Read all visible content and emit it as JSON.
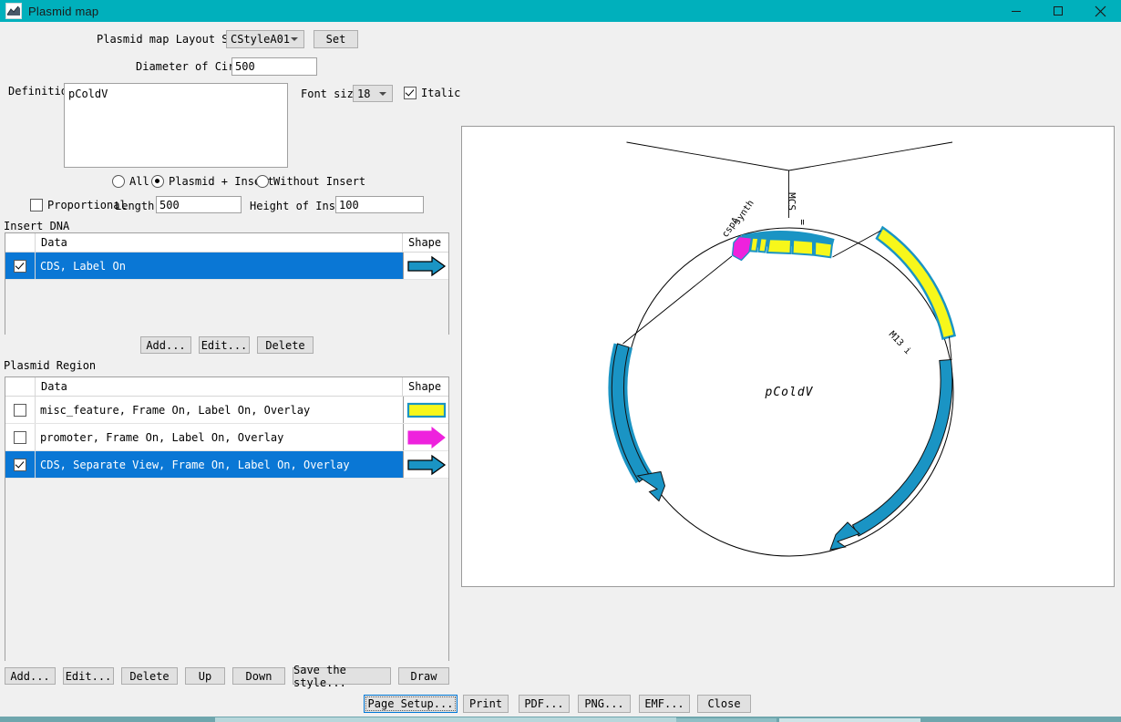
{
  "window": {
    "title": "Plasmid map",
    "icon": "plasmid-map-icon",
    "minimize": "–",
    "maximize": "□",
    "close": "✕",
    "titlebar_color": "#00b0bc"
  },
  "form": {
    "layout_style_label": "Plasmid map Layout Style:",
    "layout_style_value": "CStyleA01",
    "set_button": "Set",
    "diameter_label": "Diameter of Circle:",
    "diameter_value": "500",
    "definition_label": "Definition:",
    "definition_value": "pColdV",
    "font_size_label": "Font size:",
    "font_size_value": "18",
    "italic_label": "Italic",
    "italic_checked": true
  },
  "scope": {
    "options": [
      {
        "label": "All",
        "selected": false
      },
      {
        "label": "Plasmid + Insert",
        "selected": true
      },
      {
        "label": "Without Insert",
        "selected": false
      }
    ]
  },
  "dimensions": {
    "proportional_label": "Proportional",
    "proportional_checked": false,
    "length_label": "Length:",
    "length_value": "500",
    "height_label": "Height of Insert:",
    "height_value": "100"
  },
  "insert_dna": {
    "group_label": "Insert DNA",
    "columns": [
      "",
      "Data",
      "Shape"
    ],
    "rows": [
      {
        "checked": true,
        "data": "CDS, Label On",
        "shape": "arrow-right-teal",
        "selected": true
      }
    ],
    "buttons": [
      "Add...",
      "Edit...",
      "Delete"
    ]
  },
  "plasmid_region": {
    "group_label": "Plasmid Region",
    "columns": [
      "",
      "Data",
      "Shape"
    ],
    "rows": [
      {
        "checked": false,
        "data": "misc_feature, Frame On, Label On, Overlay",
        "shape": "rect-yellow",
        "selected": false
      },
      {
        "checked": false,
        "data": "promoter, Frame On, Label On, Overlay",
        "shape": "arrow-right-magenta",
        "selected": false
      },
      {
        "checked": true,
        "data": "CDS, Separate View, Frame On, Label On, Overlay",
        "shape": "arrow-right-teal",
        "selected": true
      }
    ],
    "buttons": [
      "Add...",
      "Edit...",
      "Delete",
      "Up",
      "Down",
      "Save the style...",
      "Draw"
    ]
  },
  "actions": {
    "buttons": [
      {
        "label": "Page Setup...",
        "focused": true
      },
      {
        "label": "Print",
        "focused": false
      },
      {
        "label": "PDF...",
        "focused": false
      },
      {
        "label": "PNG...",
        "focused": false
      },
      {
        "label": "EMF...",
        "focused": false
      },
      {
        "label": "Close",
        "focused": false
      }
    ]
  },
  "map": {
    "center_label": "pColdV",
    "feature_labels": {
      "cspA": "cspA",
      "synth": "synth",
      "mcs": "MCS",
      "mcs_sub": "=",
      "m13": "M13 i"
    },
    "colors": {
      "cds_teal": "#1a94c4",
      "misc_yellow": "#f7f71b",
      "promoter_magenta": "#ee22dd",
      "outline_teal": "#1a94c4",
      "circle_line": "#000000"
    }
  }
}
